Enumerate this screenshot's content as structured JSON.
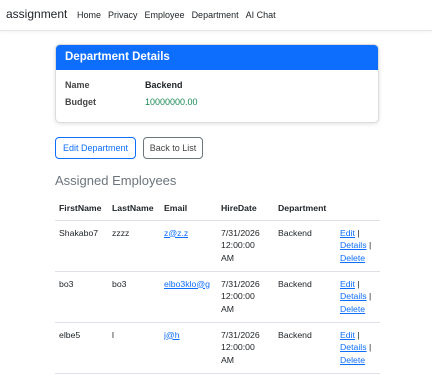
{
  "nav": {
    "brand": "assignment",
    "links": [
      "Home",
      "Privacy",
      "Employee",
      "Department",
      "AI Chat"
    ]
  },
  "card": {
    "header": "Department Details",
    "name_label": "Name",
    "name_value": "Backend",
    "budget_label": "Budget",
    "budget_value": "10000000.00"
  },
  "buttons": {
    "edit": "Edit Department",
    "back": "Back to List"
  },
  "section_title": "Assigned Employees",
  "table": {
    "headers": [
      "FirstName",
      "LastName",
      "Email",
      "HireDate",
      "Department"
    ],
    "rows": [
      {
        "first": "Shakabo7",
        "last": "zzzz",
        "email": "z@z.z",
        "hire_date": "7/31/2026",
        "hire_time": "12:00:00",
        "hire_ampm": "AM",
        "department": "Backend"
      },
      {
        "first": "bo3",
        "last": "bo3",
        "email": "elbo3klo@g",
        "hire_date": "7/31/2026",
        "hire_time": "12:00:00",
        "hire_ampm": "AM",
        "department": "Backend"
      },
      {
        "first": "elbe5",
        "last": "l",
        "email": "j@h",
        "hire_date": "7/31/2026",
        "hire_time": "12:00:00",
        "hire_ampm": "AM",
        "department": "Backend"
      }
    ],
    "actions": {
      "edit": "Edit",
      "details": "Details",
      "delete": "Delete",
      "separator": "|"
    }
  },
  "colors": {
    "primary": "#0d6efd",
    "budget": "#198754",
    "muted": "#6c757d"
  }
}
